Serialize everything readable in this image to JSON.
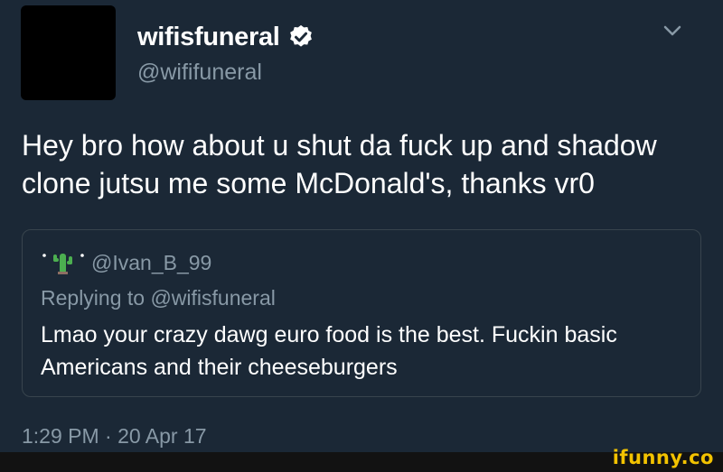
{
  "tweet": {
    "display_name": "wifisfuneral",
    "handle": "@wififuneral",
    "text": "Hey bro how about u shut da fuck up and shadow clone jutsu me some McDonald's, thanks vr0",
    "timestamp": "1:29 PM · 20 Apr 17",
    "icons": {
      "verified": "verified-badge-icon",
      "menu": "chevron-down-icon"
    }
  },
  "quoted_tweet": {
    "handle": "@Ivan_B_99",
    "replying_to": "Replying to @wifisfuneral",
    "text": "Lmao your crazy dawg euro food is the best. Fuckin basic Americans and their cheeseburgers",
    "icons": {
      "avatar": "cactus-icon"
    }
  },
  "watermark": {
    "text": "ifunny.co"
  },
  "colors": {
    "background": "#1b2836",
    "primary_text": "#ffffff",
    "secondary_text": "#8899a6",
    "border": "#38444d",
    "watermark": "#f2c200"
  }
}
